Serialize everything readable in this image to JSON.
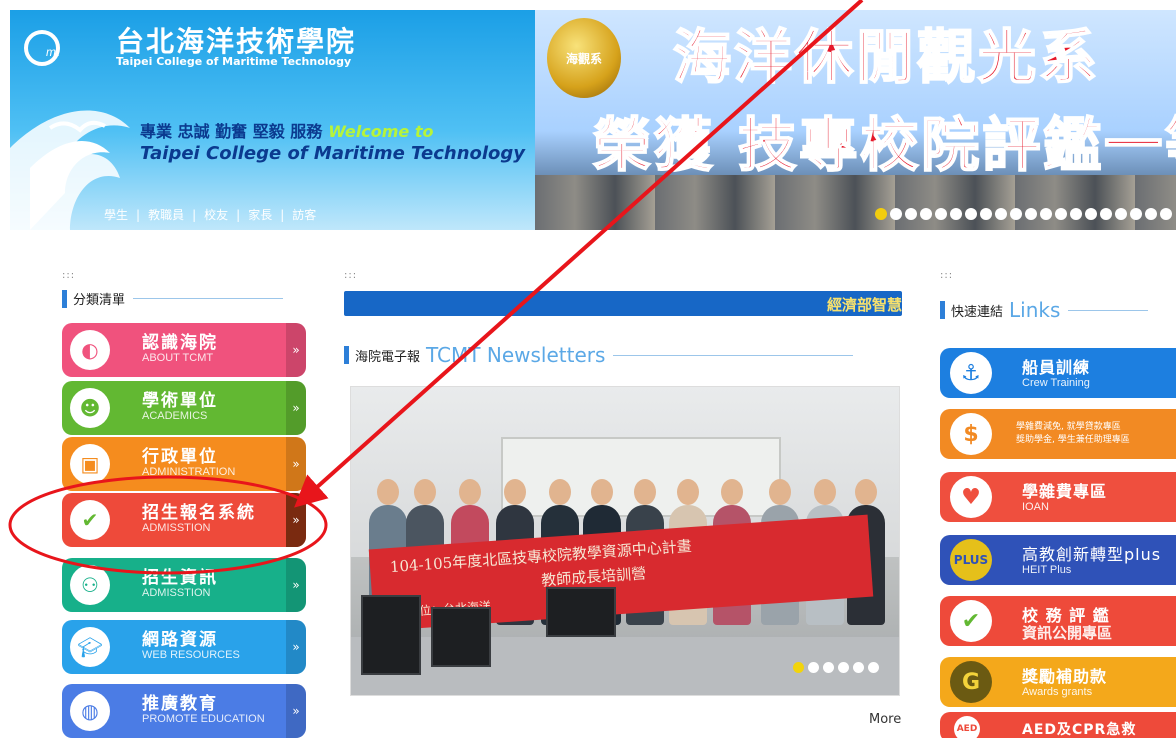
{
  "header": {
    "school_name_cn": "台北海洋技術學院",
    "school_name_en": "Taipei College of Maritime Technology",
    "motto": "專業 忠誠 勤奮 堅毅 服務",
    "welcome": "Welcome to",
    "motto_en": "Taipei College of Maritime Technology",
    "nav": [
      "學生",
      "教職員",
      "校友",
      "家長",
      "訪客"
    ],
    "nav_separator": "|",
    "banner_badge": "海觀系",
    "banner_line1": "海洋休閒觀光系",
    "banner_line2": "榮獲 技專校院評鑑一等"
  },
  "left": {
    "dots": ":::",
    "section_title": "分類清單",
    "arrow": "»",
    "items": [
      {
        "cn": "認識海院",
        "en": "ABOUT TCMT",
        "color": "#f0527d",
        "icon": "logo-icon"
      },
      {
        "cn": "學術單位",
        "en": "ACADEMICS",
        "color": "#62b832",
        "icon": "person-icon"
      },
      {
        "cn": "行政單位",
        "en": "ADMINISTRATION",
        "color": "#f58c1e",
        "icon": "monitor-icon"
      },
      {
        "cn": "招生報名系統",
        "en": "ADMISSTION",
        "color": "#ee4a3a",
        "icon": "checklist-icon"
      },
      {
        "cn": "招生資訊",
        "en": "ADMISSTION",
        "color": "#17b08a",
        "icon": "people-icon"
      },
      {
        "cn": "網路資源",
        "en": "WEB RESOURCES",
        "color": "#29a2ea",
        "icon": "graduation-cap-icon"
      },
      {
        "cn": "推廣教育",
        "en": "PROMOTE EDUCATION",
        "color": "#4b7ce5",
        "icon": "globe-hand-icon"
      }
    ]
  },
  "middle": {
    "dots": ":::",
    "ticker_text": "經濟部智慧",
    "section_title_cn": "海院電子報",
    "section_title_en": "TCMT Newsletters",
    "banner_text1": "104-105年度北區技專校院教學資源中心計畫",
    "banner_text2": "教師成長培訓營",
    "banner_text3": "主辦單位：台北海洋",
    "more": "More"
  },
  "right": {
    "dots": ":::",
    "section_title_cn": "快速連結",
    "section_title_en": "Links",
    "links": [
      {
        "cn": "船員訓練",
        "en": "Crew Training",
        "color": "#1d7fe0",
        "icon": "anchor-icon"
      },
      {
        "small1": "學雜費減免, 就學貸款專區",
        "small2": "獎助學金, 學生兼任助理專區",
        "color": "#f28a23",
        "icon": "dollar-icon"
      },
      {
        "cn": "學雜費專區",
        "en": "IOAN",
        "color": "#ef4f3e",
        "icon": "piggy-bank-icon"
      },
      {
        "cn": "高教創新轉型plus",
        "en": "HEIT Plus",
        "color": "#2f52b8",
        "icon": "plus-badge-icon"
      },
      {
        "cn": "校 務 評 鑑",
        "en2": "資訊公開專區",
        "color": "#ee4a3a",
        "icon": "checklist-icon"
      },
      {
        "cn": "獎勵補助款",
        "en": "Awards grants",
        "color": "#f4a81b",
        "icon": "g-coin-icon"
      },
      {
        "cn": "AED及CPR急救",
        "color": "#ee4a3a",
        "icon": "aed-icon"
      }
    ]
  },
  "colors": {
    "annotation_red": "#e8151b",
    "accent_blue": "#2d7fd8"
  }
}
